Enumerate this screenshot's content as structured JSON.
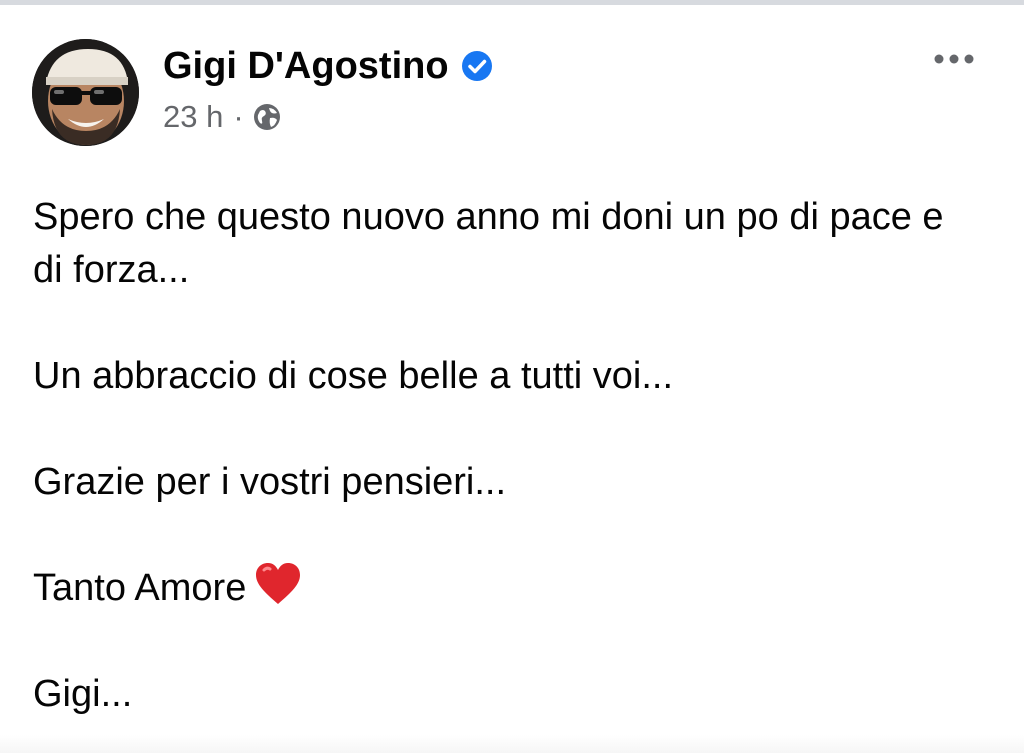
{
  "post": {
    "author_name": "Gigi D'Agostino",
    "verified": true,
    "time": "23 h",
    "separator": "·",
    "audience_icon": "globe-icon",
    "more_icon": "more-options-icon",
    "paragraphs": [
      "Spero che questo nuovo anno mi doni un po di pace e di forza...",
      "Un abbraccio di cose belle a tutti voi...",
      "Grazie per i vostri pensieri...",
      "Tanto Amore",
      "Gigi..."
    ],
    "heart_icon": "red-heart-emoji-icon"
  },
  "colors": {
    "text": "#050505",
    "secondary_text": "#65676b",
    "verified_blue": "#1877f2",
    "heart_red": "#e0262d"
  }
}
